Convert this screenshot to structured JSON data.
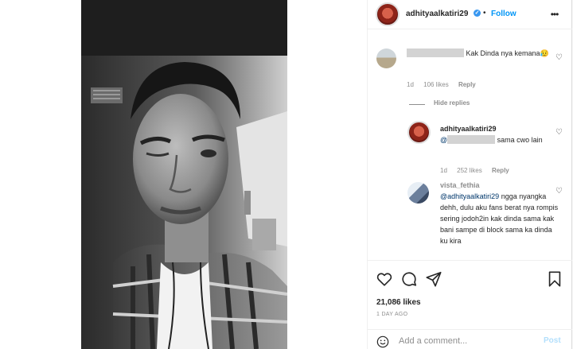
{
  "header": {
    "username": "adhityaalkatiri29",
    "follow_label": "Follow",
    "bullet": "•"
  },
  "comments": [
    {
      "text_before": "",
      "text_after": " Kak Dinda nya kemana😥",
      "time": "1d",
      "likes": "106 likes",
      "reply_label": "Reply"
    }
  ],
  "hide_replies_label": "Hide replies",
  "replies": [
    {
      "username": "adhityaalkatiri29",
      "mention_prefix": "@",
      "text_after": " sama cwo lain",
      "time": "1d",
      "likes": "252 likes",
      "reply_label": "Reply"
    },
    {
      "username": "vista_fethia",
      "mention": "@adhityaalkatiri29",
      "text": " ngga nyangka dehh, dulu aku fans berat nya rompis sering jodoh2in kak dinda sama kak bani sampe di block sama ka dinda ku kira"
    }
  ],
  "actions": {
    "likes": "21,086 likes",
    "posted": "1 DAY AGO"
  },
  "add_comment": {
    "placeholder": "Add a comment...",
    "post_label": "Post"
  },
  "icons": {
    "header_more": "more-horizontal-icon",
    "like": "heart-outline-icon",
    "comment": "comment-bubble-icon",
    "share": "paper-plane-icon",
    "save": "bookmark-icon",
    "emoji": "smiley-icon"
  },
  "colors": {
    "accent": "#0095f6",
    "muted": "#8e8e8e",
    "text": "#262626",
    "border": "#efefef"
  }
}
